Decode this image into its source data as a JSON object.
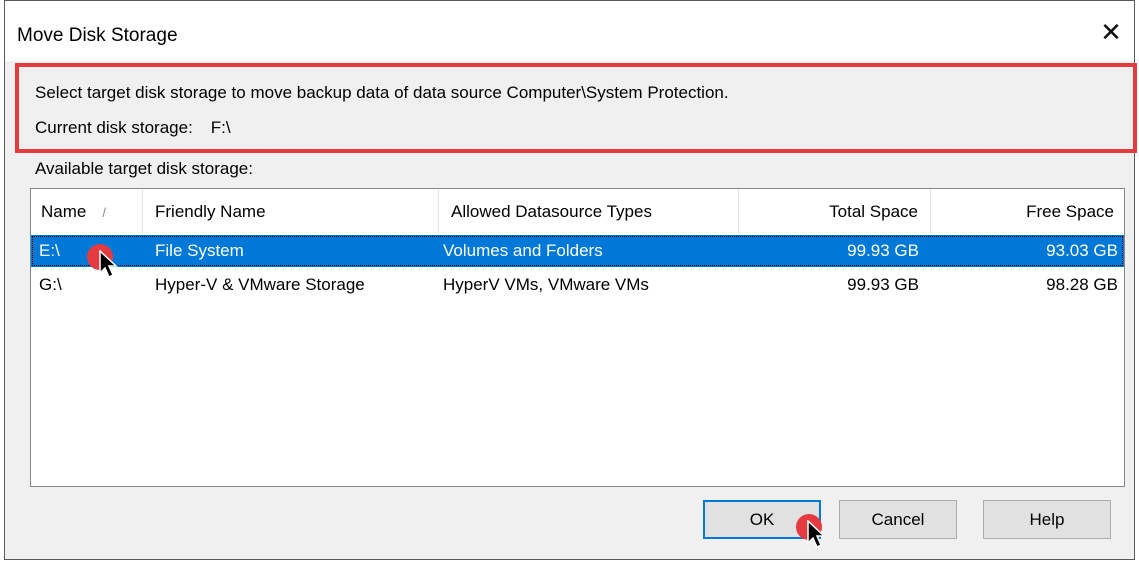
{
  "window": {
    "title": "Move Disk Storage",
    "close_glyph": "✕"
  },
  "info": {
    "instruction": "Select target disk storage to move backup data of data source Computer\\System Protection.",
    "current_label": "Current disk storage:",
    "current_value": "F:\\"
  },
  "list": {
    "label": "Available target disk storage:",
    "columns": {
      "name": "Name",
      "friendly_name": "Friendly Name",
      "allowed_types": "Allowed Datasource Types",
      "total_space": "Total Space",
      "free_space": "Free Space"
    },
    "sort_indicator": "/",
    "rows": [
      {
        "name": "E:\\",
        "friendly_name": "File System",
        "allowed_types": "Volumes and Folders",
        "total_space": "99.93 GB",
        "free_space": "93.03 GB",
        "selected": true
      },
      {
        "name": "G:\\",
        "friendly_name": "Hyper-V & VMware Storage",
        "allowed_types": "HyperV VMs, VMware VMs",
        "total_space": "99.93 GB",
        "free_space": "98.28 GB",
        "selected": false
      }
    ]
  },
  "buttons": {
    "ok": "OK",
    "cancel": "Cancel",
    "help": "Help"
  },
  "colors": {
    "highlight_border": "#e53a40",
    "selection": "#0078d7",
    "click_marker": "#e53a40"
  }
}
